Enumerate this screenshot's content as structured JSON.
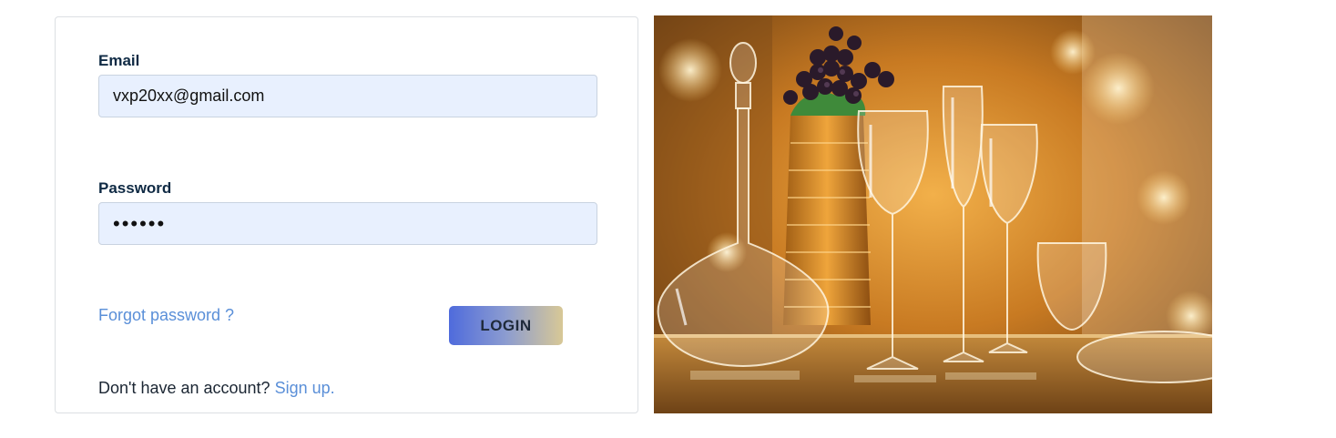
{
  "login_form": {
    "email_label": "Email",
    "email_value": "vxp20xx@gmail.com",
    "password_label": "Password",
    "password_value": "••••••",
    "forgot_password_label": "Forgot password ?",
    "login_button_label": "LOGIN",
    "signup_prompt": "Don't have an account?",
    "signup_link_label": "Sign up."
  },
  "hero": {
    "image_subject": "crystal-glassware-photo"
  },
  "colors": {
    "input_background": "#e8f0fe",
    "link": "#5a8fd8",
    "label": "#0f2a44",
    "button_gradient_start": "#4f6bdc",
    "button_gradient_end": "#d8c896"
  }
}
